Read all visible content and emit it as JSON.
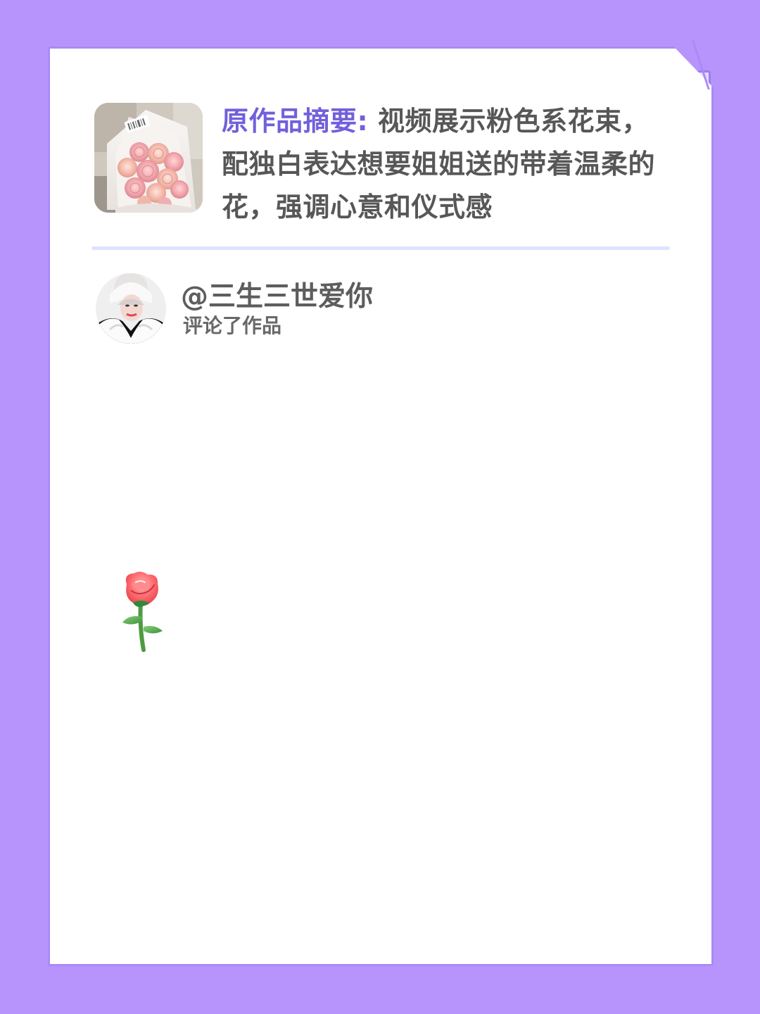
{
  "summary": {
    "label": "原作品摘要:",
    "text": "视频展示粉色系花束，配独白表达想要姐姐送的带着温柔的花，强调心意和仪式感",
    "thumbnail_icon": "bouquet-thumbnail"
  },
  "comment": {
    "username": "@三生三世爱你",
    "action": "评论了作品",
    "avatar_icon": "user-avatar",
    "content_emoji": "🌹",
    "content_icon": "rose-icon"
  },
  "colors": {
    "background": "#b794fb",
    "paper": "#ffffff",
    "paper_border": "#a98af5",
    "accent_label": "#7160db",
    "text": "#575757",
    "divider": "#dde3ff"
  }
}
